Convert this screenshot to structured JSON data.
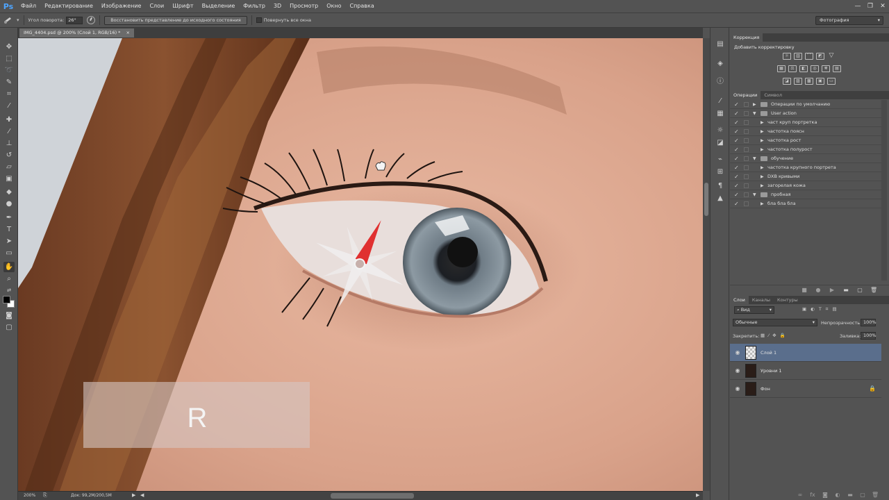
{
  "app": {
    "logo": "Ps"
  },
  "menu": [
    "Файл",
    "Редактирование",
    "Изображение",
    "Слои",
    "Шрифт",
    "Выделение",
    "Фильтр",
    "3D",
    "Просмотр",
    "Окно",
    "Справка"
  ],
  "window_controls": {
    "minimize": "—",
    "restore": "❐",
    "close": "✕"
  },
  "options": {
    "rotation_label": "Угол поворота:",
    "rotation_value": "26°",
    "reset_button": "Восстановить представление до исходного состояния",
    "rotate_all_label": "Повернуть все окна",
    "workspace": "Фотография"
  },
  "document": {
    "tab_title": "IMG_4404.psd @ 200% (Слой 1, RGB/16) *",
    "close_symbol": "×"
  },
  "overlay": {
    "key_hint": "R"
  },
  "status": {
    "zoom": "200%",
    "doc_size": "Док: 99,2M/200,5M"
  },
  "panels": {
    "adjustments": {
      "tab": "Коррекция",
      "title": "Добавить корректировку"
    },
    "actions": {
      "tabs": [
        "Операции",
        "Символ"
      ],
      "rows": [
        {
          "label": "Операции по умолчанию",
          "level": 0,
          "expanded": false,
          "folder": true
        },
        {
          "label": "User action",
          "level": 0,
          "expanded": true,
          "folder": true
        },
        {
          "label": "част круп портретка",
          "level": 1,
          "expanded": false,
          "folder": false
        },
        {
          "label": "частотка поясн",
          "level": 1,
          "expanded": false,
          "folder": false
        },
        {
          "label": "частотка рост",
          "level": 1,
          "expanded": false,
          "folder": false
        },
        {
          "label": "частотка полурост",
          "level": 1,
          "expanded": false,
          "folder": false
        },
        {
          "label": "обучение",
          "level": 0,
          "expanded": true,
          "folder": true
        },
        {
          "label": "частотка крупного портрета",
          "level": 1,
          "expanded": false,
          "folder": false
        },
        {
          "label": "DXB кривыми",
          "level": 1,
          "expanded": false,
          "folder": false
        },
        {
          "label": "загорелая кожа",
          "level": 1,
          "expanded": false,
          "folder": false
        },
        {
          "label": "пробная",
          "level": 0,
          "expanded": true,
          "folder": true
        },
        {
          "label": "бла бла бла",
          "level": 1,
          "expanded": false,
          "folder": false
        }
      ]
    },
    "layers": {
      "tabs": [
        "Слои",
        "Каналы",
        "Контуры"
      ],
      "filter_kind": "Вид",
      "blend_mode": "Обычные",
      "opacity_label": "Непрозрачность:",
      "opacity_value": "100%",
      "lock_label": "Закрепить:",
      "fill_label": "Заливка:",
      "fill_value": "100%",
      "items": [
        {
          "name": "Слой 1",
          "selected": true,
          "locked": false
        },
        {
          "name": "Уровни 1",
          "selected": false,
          "locked": false
        },
        {
          "name": "Фон",
          "selected": false,
          "locked": true
        }
      ]
    }
  },
  "colors": {
    "accent": "#4ea5ff",
    "selected_layer": "#5a6e8c",
    "compass_needle": "#e03030"
  }
}
